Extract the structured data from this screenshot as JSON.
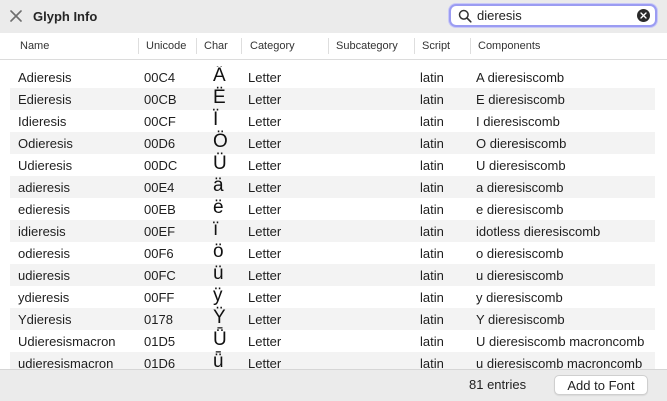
{
  "window": {
    "title": "Glyph Info"
  },
  "search": {
    "value": "dieresis"
  },
  "columns": [
    "Name",
    "Unicode",
    "Char",
    "Category",
    "Subcategory",
    "Script",
    "Components"
  ],
  "rows": [
    {
      "name": "Adieresis",
      "unicode": "00C4",
      "char": "Ä",
      "category": "Letter",
      "subcategory": "",
      "script": "latin",
      "components": "A dieresiscomb"
    },
    {
      "name": "Edieresis",
      "unicode": "00CB",
      "char": "Ë",
      "category": "Letter",
      "subcategory": "",
      "script": "latin",
      "components": "E dieresiscomb"
    },
    {
      "name": "Idieresis",
      "unicode": "00CF",
      "char": "Ï",
      "category": "Letter",
      "subcategory": "",
      "script": "latin",
      "components": "I dieresiscomb"
    },
    {
      "name": "Odieresis",
      "unicode": "00D6",
      "char": "Ö",
      "category": "Letter",
      "subcategory": "",
      "script": "latin",
      "components": "O dieresiscomb"
    },
    {
      "name": "Udieresis",
      "unicode": "00DC",
      "char": "Ü",
      "category": "Letter",
      "subcategory": "",
      "script": "latin",
      "components": "U dieresiscomb"
    },
    {
      "name": "adieresis",
      "unicode": "00E4",
      "char": "ä",
      "category": "Letter",
      "subcategory": "",
      "script": "latin",
      "components": "a dieresiscomb"
    },
    {
      "name": "edieresis",
      "unicode": "00EB",
      "char": "ë",
      "category": "Letter",
      "subcategory": "",
      "script": "latin",
      "components": "e dieresiscomb"
    },
    {
      "name": "idieresis",
      "unicode": "00EF",
      "char": "ï",
      "category": "Letter",
      "subcategory": "",
      "script": "latin",
      "components": "idotless dieresiscomb"
    },
    {
      "name": "odieresis",
      "unicode": "00F6",
      "char": "ö",
      "category": "Letter",
      "subcategory": "",
      "script": "latin",
      "components": "o dieresiscomb"
    },
    {
      "name": "udieresis",
      "unicode": "00FC",
      "char": "ü",
      "category": "Letter",
      "subcategory": "",
      "script": "latin",
      "components": "u dieresiscomb"
    },
    {
      "name": "ydieresis",
      "unicode": "00FF",
      "char": "ÿ",
      "category": "Letter",
      "subcategory": "",
      "script": "latin",
      "components": "y dieresiscomb"
    },
    {
      "name": "Ydieresis",
      "unicode": "0178",
      "char": "Ÿ",
      "category": "Letter",
      "subcategory": "",
      "script": "latin",
      "components": "Y dieresiscomb"
    },
    {
      "name": "Udieresismacron",
      "unicode": "01D5",
      "char": "Ǖ",
      "category": "Letter",
      "subcategory": "",
      "script": "latin",
      "components": "U dieresiscomb macroncomb"
    },
    {
      "name": "udieresismacron",
      "unicode": "01D6",
      "char": "ǖ",
      "category": "Letter",
      "subcategory": "",
      "script": "latin",
      "components": "u dieresiscomb macroncomb"
    }
  ],
  "footer": {
    "entries": "81 entries",
    "add_button": "Add to Font"
  },
  "icons": {
    "close": "close-icon",
    "search": "search-icon",
    "clear": "clear-search-icon"
  },
  "colors": {
    "search_focus": "#9b9cf2",
    "stripe": "#f3f3f3",
    "chrome": "#ebebeb"
  }
}
